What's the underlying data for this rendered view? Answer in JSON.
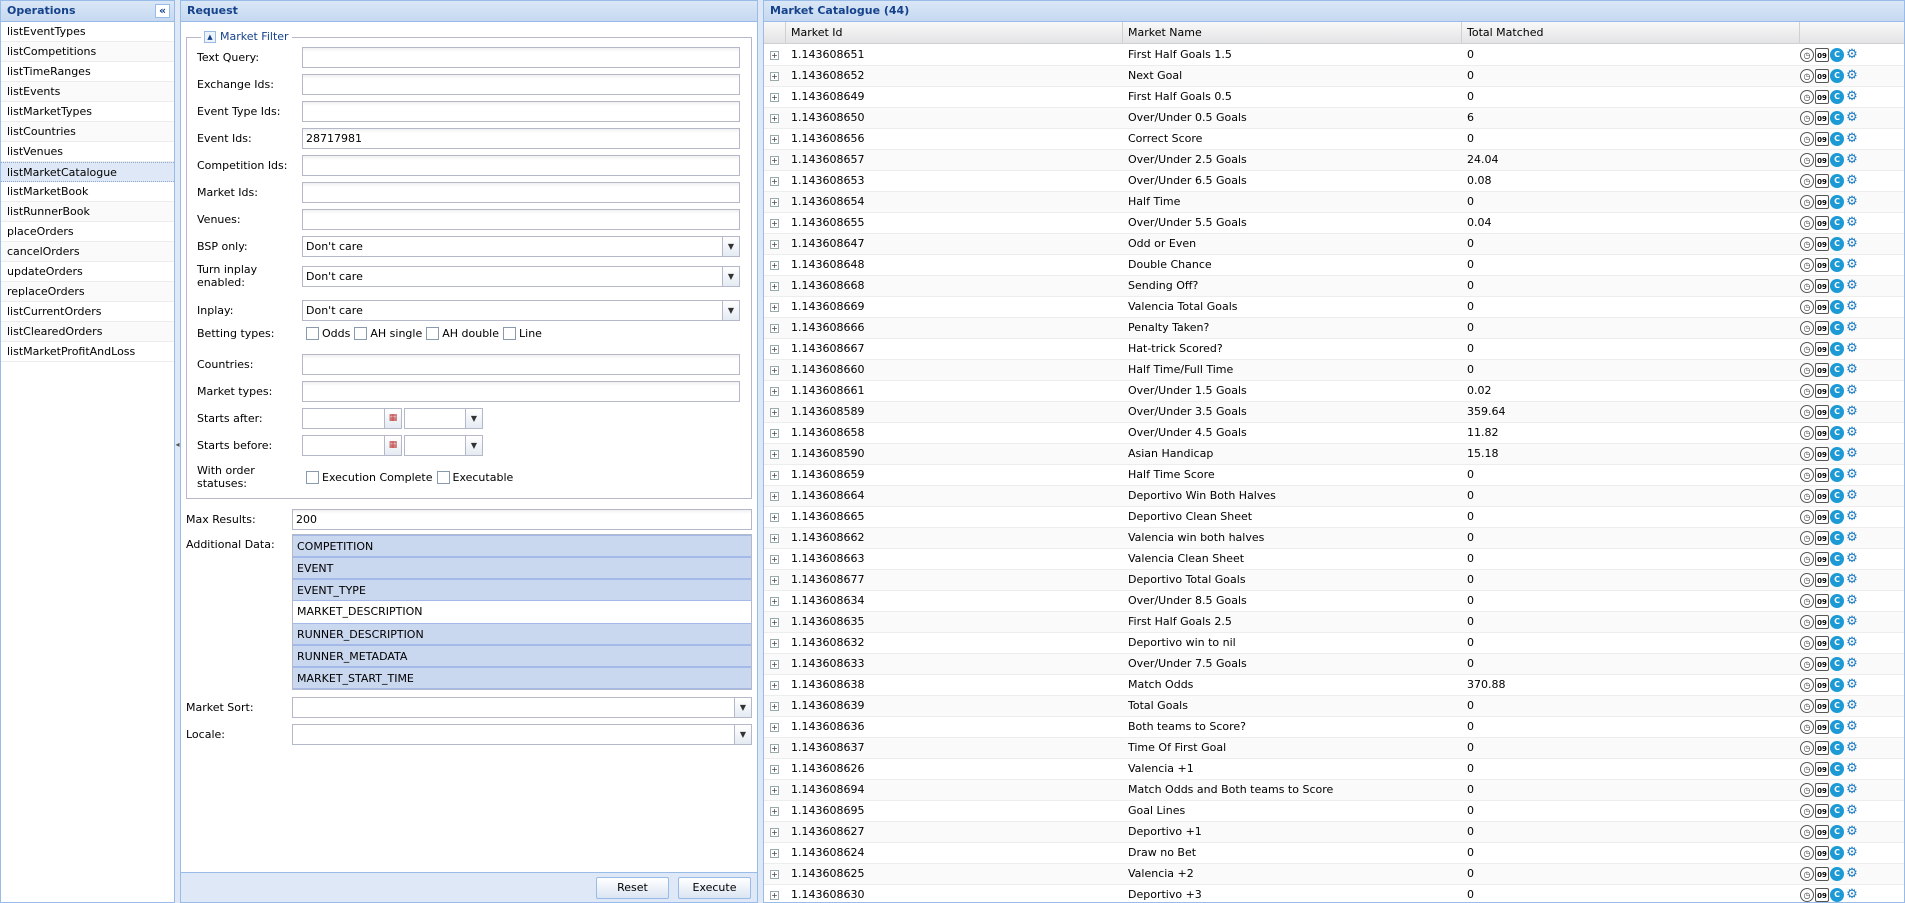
{
  "operations": {
    "title": "Operations",
    "collapse": "«",
    "items": [
      "listEventTypes",
      "listCompetitions",
      "listTimeRanges",
      "listEvents",
      "listMarketTypes",
      "listCountries",
      "listVenues",
      "listMarketCatalogue",
      "listMarketBook",
      "listRunnerBook",
      "placeOrders",
      "cancelOrders",
      "updateOrders",
      "replaceOrders",
      "listCurrentOrders",
      "listClearedOrders",
      "listMarketProfitAndLoss"
    ],
    "selected_index": 7
  },
  "request": {
    "title": "Request",
    "filter": {
      "legend": "Market Filter",
      "text_query": {
        "label": "Text Query:",
        "value": ""
      },
      "exchange_ids": {
        "label": "Exchange Ids:",
        "value": ""
      },
      "event_type_ids": {
        "label": "Event Type Ids:",
        "value": ""
      },
      "event_ids": {
        "label": "Event Ids:",
        "value": "28717981"
      },
      "competition_ids": {
        "label": "Competition Ids:",
        "value": ""
      },
      "market_ids": {
        "label": "Market Ids:",
        "value": ""
      },
      "venues": {
        "label": "Venues:",
        "value": ""
      },
      "bsp_only": {
        "label": "BSP only:",
        "value": "Don't care"
      },
      "turn_inplay": {
        "label": "Turn inplay enabled:",
        "value": "Don't care"
      },
      "inplay": {
        "label": "Inplay:",
        "value": "Don't care"
      },
      "betting_types": {
        "label": "Betting types:",
        "options": [
          "Odds",
          "AH single",
          "AH double",
          "Line"
        ]
      },
      "countries": {
        "label": "Countries:",
        "value": ""
      },
      "market_types": {
        "label": "Market types:",
        "value": ""
      },
      "starts_after": {
        "label": "Starts after:"
      },
      "starts_before": {
        "label": "Starts before:"
      },
      "order_statuses": {
        "label": "With order statuses:",
        "options": [
          "Execution Complete",
          "Executable"
        ]
      }
    },
    "max_results": {
      "label": "Max Results:",
      "value": "200"
    },
    "additional_data": {
      "label": "Additional Data:",
      "items": [
        {
          "name": "COMPETITION",
          "selected": true
        },
        {
          "name": "EVENT",
          "selected": true
        },
        {
          "name": "EVENT_TYPE",
          "selected": true
        },
        {
          "name": "MARKET_DESCRIPTION",
          "selected": false
        },
        {
          "name": "RUNNER_DESCRIPTION",
          "selected": true
        },
        {
          "name": "RUNNER_METADATA",
          "selected": true
        },
        {
          "name": "MARKET_START_TIME",
          "selected": true
        }
      ]
    },
    "market_sort": {
      "label": "Market Sort:",
      "value": ""
    },
    "locale": {
      "label": "Locale:",
      "value": ""
    },
    "reset_label": "Reset",
    "execute_label": "Execute"
  },
  "catalogue": {
    "title": "Market Catalogue (44)",
    "columns": [
      "Market Id",
      "Market Name",
      "Total Matched"
    ],
    "icons": [
      "clock-icon",
      "calendar-icon",
      "c-icon",
      "gear-icon"
    ],
    "rows": [
      [
        "1.143608651",
        "First Half Goals 1.5",
        "0"
      ],
      [
        "1.143608652",
        "Next Goal",
        "0"
      ],
      [
        "1.143608649",
        "First Half Goals 0.5",
        "0"
      ],
      [
        "1.143608650",
        "Over/Under 0.5 Goals",
        "6"
      ],
      [
        "1.143608656",
        "Correct Score",
        "0"
      ],
      [
        "1.143608657",
        "Over/Under 2.5 Goals",
        "24.04"
      ],
      [
        "1.143608653",
        "Over/Under 6.5 Goals",
        "0.08"
      ],
      [
        "1.143608654",
        "Half Time",
        "0"
      ],
      [
        "1.143608655",
        "Over/Under 5.5 Goals",
        "0.04"
      ],
      [
        "1.143608647",
        "Odd or Even",
        "0"
      ],
      [
        "1.143608648",
        "Double Chance",
        "0"
      ],
      [
        "1.143608668",
        "Sending Off?",
        "0"
      ],
      [
        "1.143608669",
        "Valencia Total Goals",
        "0"
      ],
      [
        "1.143608666",
        "Penalty Taken?",
        "0"
      ],
      [
        "1.143608667",
        "Hat-trick Scored?",
        "0"
      ],
      [
        "1.143608660",
        "Half Time/Full Time",
        "0"
      ],
      [
        "1.143608661",
        "Over/Under 1.5 Goals",
        "0.02"
      ],
      [
        "1.143608589",
        "Over/Under 3.5 Goals",
        "359.64"
      ],
      [
        "1.143608658",
        "Over/Under 4.5 Goals",
        "11.82"
      ],
      [
        "1.143608590",
        "Asian Handicap",
        "15.18"
      ],
      [
        "1.143608659",
        "Half Time Score",
        "0"
      ],
      [
        "1.143608664",
        "Deportivo Win Both Halves",
        "0"
      ],
      [
        "1.143608665",
        "Deportivo Clean Sheet",
        "0"
      ],
      [
        "1.143608662",
        "Valencia win both halves",
        "0"
      ],
      [
        "1.143608663",
        "Valencia Clean Sheet",
        "0"
      ],
      [
        "1.143608677",
        "Deportivo Total Goals",
        "0"
      ],
      [
        "1.143608634",
        "Over/Under 8.5 Goals",
        "0"
      ],
      [
        "1.143608635",
        "First Half Goals 2.5",
        "0"
      ],
      [
        "1.143608632",
        "Deportivo win to nil",
        "0"
      ],
      [
        "1.143608633",
        "Over/Under 7.5 Goals",
        "0"
      ],
      [
        "1.143608638",
        "Match Odds",
        "370.88"
      ],
      [
        "1.143608639",
        "Total Goals",
        "0"
      ],
      [
        "1.143608636",
        "Both teams to Score?",
        "0"
      ],
      [
        "1.143608637",
        "Time Of First Goal",
        "0"
      ],
      [
        "1.143608626",
        "Valencia +1",
        "0"
      ],
      [
        "1.143608694",
        "Match Odds and Both teams to Score",
        "0"
      ],
      [
        "1.143608695",
        "Goal Lines",
        "0"
      ],
      [
        "1.143608627",
        "Deportivo +1",
        "0"
      ],
      [
        "1.143608624",
        "Draw no Bet",
        "0"
      ],
      [
        "1.143608625",
        "Valencia +2",
        "0"
      ],
      [
        "1.143608630",
        "Deportivo +3",
        "0"
      ]
    ]
  }
}
